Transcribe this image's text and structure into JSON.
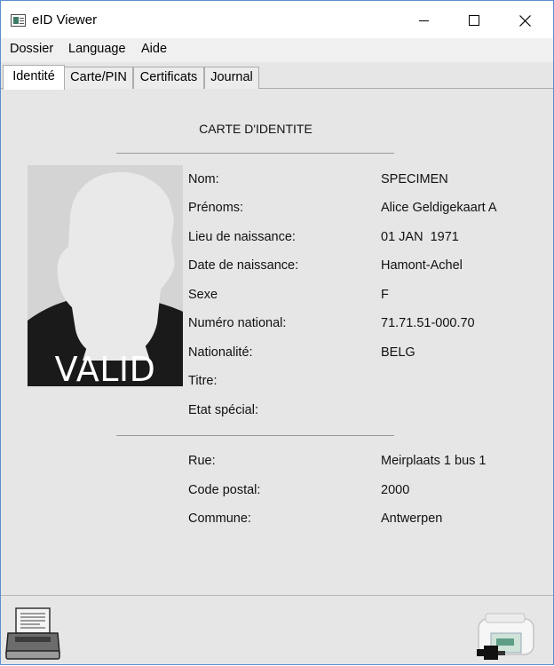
{
  "window": {
    "title": "eID Viewer"
  },
  "menu": {
    "items": [
      "Dossier",
      "Language",
      "Aide"
    ]
  },
  "tabs": [
    {
      "label": "Identité",
      "active": true
    },
    {
      "label": "Carte/PIN",
      "active": false
    },
    {
      "label": "Certificats",
      "active": false
    },
    {
      "label": "Journal",
      "active": false
    }
  ],
  "identity": {
    "section_title": "CARTE D'IDENTITE",
    "photo_overlay": "VALID",
    "fields": [
      {
        "label": "Nom:",
        "value": "SPECIMEN"
      },
      {
        "label": "Prénoms:",
        "value": "Alice Geldigekaart A"
      },
      {
        "label": "Lieu de naissance:",
        "value": "01 JAN  1971"
      },
      {
        "label": "Date de naissance:",
        "value": "Hamont-Achel"
      },
      {
        "label": "Sexe",
        "value": "F"
      },
      {
        "label": "Numéro national:",
        "value": "71.71.51-000.70"
      },
      {
        "label": "Nationalité:",
        "value": "BELG"
      },
      {
        "label": "Titre:",
        "value": ""
      },
      {
        "label": "Etat spécial:",
        "value": ""
      }
    ],
    "address": [
      {
        "label": "Rue:",
        "value": "Meirplaats 1 bus 1"
      },
      {
        "label": "Code postal:",
        "value": "2000"
      },
      {
        "label": "Commune:",
        "value": "Antwerpen"
      }
    ]
  },
  "bottom": {
    "print_icon": "printer-icon",
    "reader_icon": "card-reader-icon"
  },
  "colors": {
    "window_border": "#5b8fcf",
    "background": "#e6e6e6",
    "photo_background": "#d4d4d4",
    "photo_shirt": "#1a1a1a"
  }
}
